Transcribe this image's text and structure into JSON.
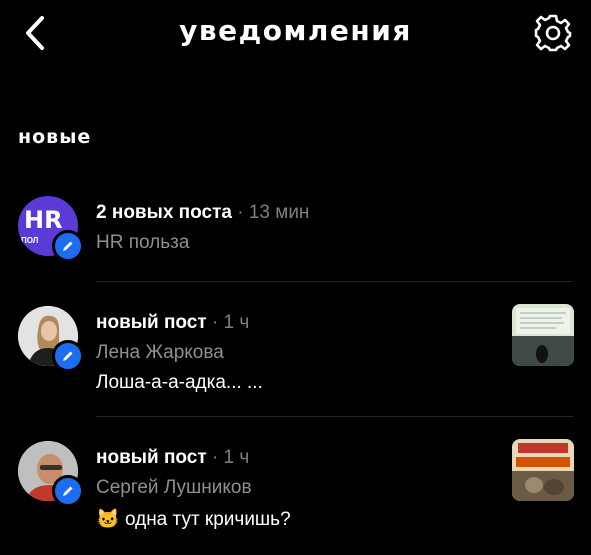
{
  "header": {
    "title": "уведомления",
    "back_icon": "chevron-left-icon",
    "settings_icon": "gear-icon"
  },
  "section_label": "новые",
  "notifications": [
    {
      "title": "2 новых поста",
      "separator": "·",
      "time": "13 мин",
      "author": "HR польза",
      "avatar_text": "HR",
      "avatar_subtext": "ПОЛ",
      "avatar_color": "#5b3bd6"
    },
    {
      "title": "новый пост",
      "separator": "·",
      "time": "1 ч",
      "author": "Лена Жаркова",
      "preview": "Лоша-а-а-адка...  ..."
    },
    {
      "title": "новый пост",
      "separator": "·",
      "time": "1 ч",
      "author": "Сергей Лушников",
      "emoji": "🐱",
      "preview": "одна тут кричишь?"
    }
  ],
  "colors": {
    "background": "#000000",
    "verified_badge": "#1d6df2",
    "muted_text": "#8f8f8f",
    "divider": "#262626"
  }
}
